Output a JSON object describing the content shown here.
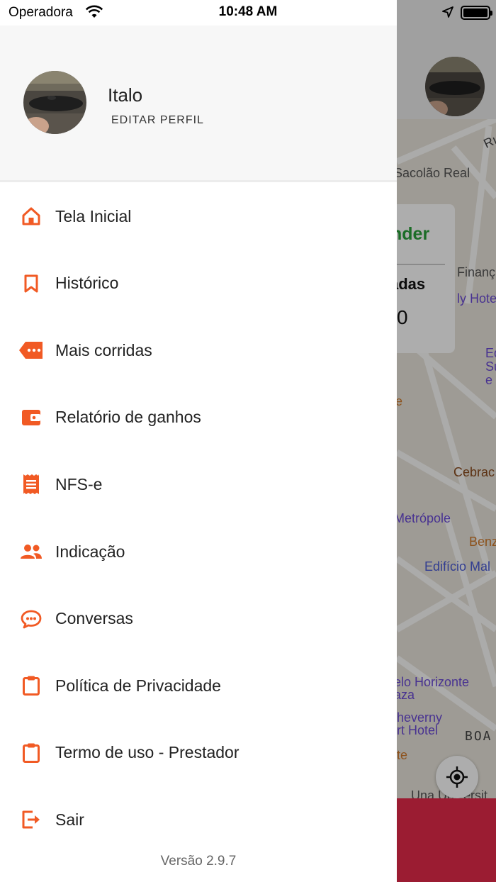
{
  "status_bar": {
    "carrier": "Operadora",
    "time": "10:48 AM",
    "wifi_icon": "wifi-icon",
    "location_icon": "location-arrow-icon",
    "battery_icon": "battery-full-icon"
  },
  "profile": {
    "name": "Italo",
    "edit_label": "EDITAR PERFIL"
  },
  "menu": {
    "items": [
      {
        "label": "Tela Inicial",
        "icon": "home-icon"
      },
      {
        "label": "Histórico",
        "icon": "bookmark-icon"
      },
      {
        "label": "Mais corridas",
        "icon": "more-tag-icon"
      },
      {
        "label": "Relatório de ganhos",
        "icon": "wallet-icon"
      },
      {
        "label": "NFS-e",
        "icon": "receipt-icon"
      },
      {
        "label": "Indicação",
        "icon": "people-icon"
      },
      {
        "label": "Conversas",
        "icon": "chat-icon"
      },
      {
        "label": "Política de Privacidade",
        "icon": "clipboard-icon"
      },
      {
        "label": "Termo de uso - Prestador",
        "icon": "clipboard-icon"
      },
      {
        "label": "Sair",
        "icon": "logout-icon"
      }
    ]
  },
  "version": "Versão 2.9.7",
  "accent_color": "#f15a24",
  "background_screen": {
    "card_title": "nder",
    "card_subtitle": "adas",
    "card_value": "0",
    "map_labels": [
      "Sacolão Real",
      "Finanç",
      "ly Hote",
      "Ed",
      "Su",
      "e",
      "Cebrac",
      "Metrópole",
      "Benz",
      "Edifício Mal",
      "elo Horizonte",
      "aza",
      "heverny",
      "rt Hotel",
      "BOA",
      "te",
      "Una Universit",
      "Rı",
      "e"
    ]
  }
}
